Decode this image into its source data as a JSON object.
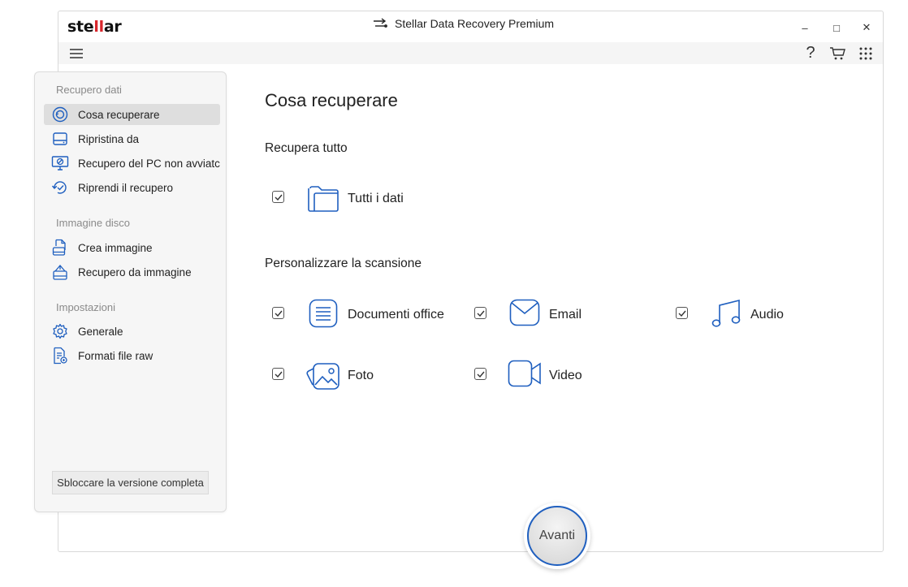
{
  "app": {
    "logo_prefix": "ste",
    "logo_mark": "ll",
    "logo_suffix": "ar",
    "title": "Stellar Data Recovery Premium"
  },
  "window_controls": {
    "minimize": "–",
    "maximize": "□",
    "close": "✕"
  },
  "toolbar": {
    "help": "?"
  },
  "sidebar": {
    "sections": [
      {
        "label": "Recupero dati"
      },
      {
        "label": "Immagine disco"
      },
      {
        "label": "Impostazioni"
      }
    ],
    "items": [
      {
        "label": "Cosa recuperare",
        "icon": "target-reset-icon",
        "active": true
      },
      {
        "label": "Ripristina da",
        "icon": "drive-icon"
      },
      {
        "label": "Recupero del PC non avviatc",
        "icon": "monitor-blocked-icon"
      },
      {
        "label": "Riprendi il recupero",
        "icon": "resume-icon"
      },
      {
        "label": "Crea immagine",
        "icon": "create-image-icon"
      },
      {
        "label": "Recupero da immagine",
        "icon": "recover-image-icon"
      },
      {
        "label": "Generale",
        "icon": "gear-icon"
      },
      {
        "label": "Formati file raw",
        "icon": "raw-file-icon"
      }
    ],
    "unlock_button": "Sbloccare la versione completa"
  },
  "main": {
    "title": "Cosa recuperare",
    "section_all": "Recupera tutto",
    "all_data": {
      "label": "Tutti i dati",
      "checked": true,
      "icon": "folder-icon"
    },
    "section_custom": "Personalizzare la scansione",
    "options": [
      {
        "label": "Documenti office",
        "checked": true,
        "icon": "document-icon"
      },
      {
        "label": "Email",
        "checked": true,
        "icon": "email-icon"
      },
      {
        "label": "Audio",
        "checked": true,
        "icon": "music-icon"
      },
      {
        "label": "Foto",
        "checked": true,
        "icon": "photo-icon"
      },
      {
        "label": "Video",
        "checked": true,
        "icon": "video-icon"
      }
    ],
    "next_button": "Avanti"
  },
  "colors": {
    "accent": "#1f5fbf",
    "brand_red": "#d8262c",
    "sidebar_bg": "#f6f6f6"
  }
}
